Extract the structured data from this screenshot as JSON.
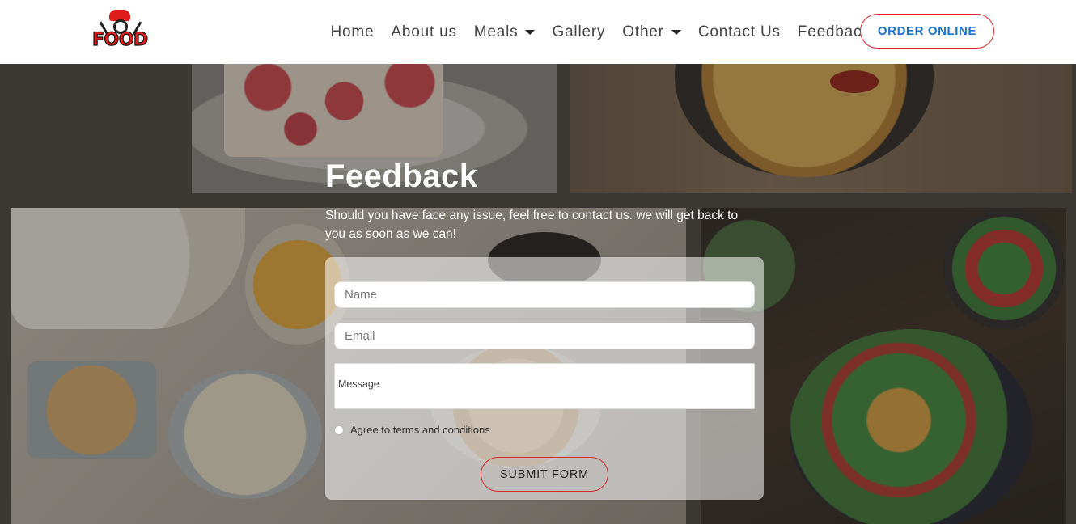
{
  "navbar": {
    "logo_text": "FOOD",
    "links": [
      {
        "label": "Home"
      },
      {
        "label": "About us"
      },
      {
        "label": "Meals"
      },
      {
        "label": "Gallery"
      },
      {
        "label": "Other"
      },
      {
        "label": "Contact Us"
      },
      {
        "label": "Feedback"
      }
    ],
    "order_button": "ORDER ONLINE"
  },
  "feedback": {
    "title": "Feedback",
    "description": "Should you have face any issue, feel free to contact us. we will get back to you as soon as we can!",
    "form": {
      "name_placeholder": "Name",
      "email_placeholder": "Email",
      "message_placeholder": "Message",
      "agree_label": "Agree to terms and conditions",
      "agree_checked": false,
      "submit_label": "SUBMIT FORM"
    }
  },
  "colors": {
    "accent_red": "#d9262b",
    "order_text_blue": "#1a73c9",
    "logo_red": "#e01b1b"
  },
  "icons": [
    "chef-hat-logo-icon",
    "fork-icon",
    "knife-icon",
    "caret-down-icon"
  ]
}
